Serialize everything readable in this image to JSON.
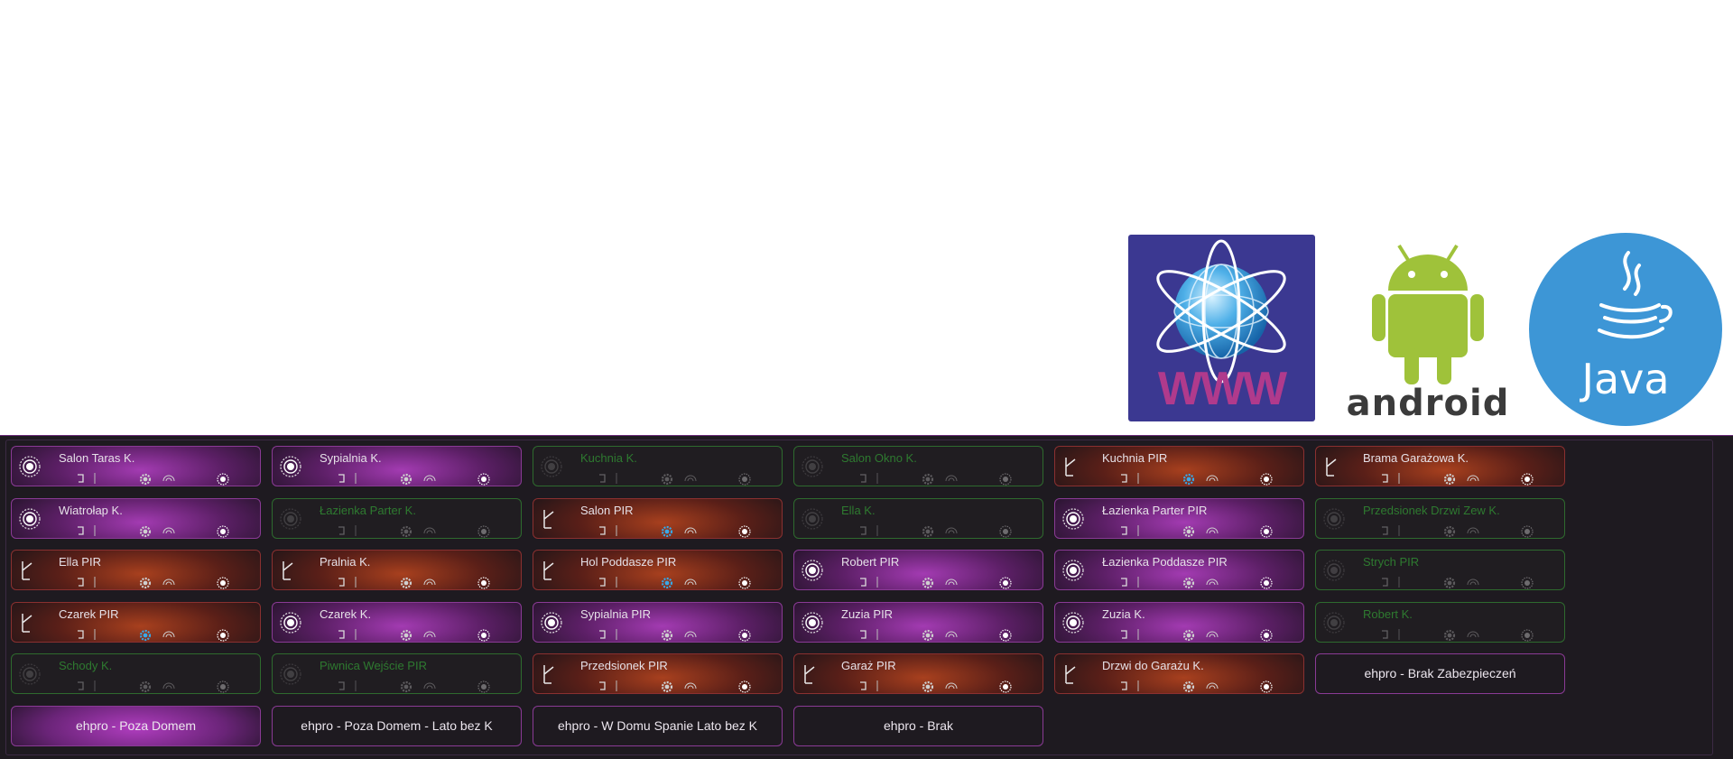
{
  "logos": {
    "www": "WWW",
    "android": "android",
    "java": "Java"
  },
  "colors": {
    "panel_bg": "#1e1a20",
    "armed_purple": "#a33bb2",
    "alarm_red": "#a8401e",
    "disabled_green": "#2e7a30"
  },
  "sensors": [
    {
      "label": "Salon Taras K.",
      "style": "purple",
      "icon": "sensor-round-icon"
    },
    {
      "label": "Sypialnia K.",
      "style": "purple",
      "icon": "sensor-round-icon"
    },
    {
      "label": "Kuchnia K.",
      "style": "green",
      "icon": "sensor-round-icon"
    },
    {
      "label": "Salon Okno K.",
      "style": "green",
      "icon": "sensor-round-icon"
    },
    {
      "label": "Kuchnia PIR",
      "style": "red",
      "icon": "pir-icon"
    },
    {
      "label": "Brama Garażowa K.",
      "style": "red",
      "icon": "pir-icon"
    },
    {
      "label": "Wiatrołap K.",
      "style": "purple",
      "icon": "sensor-round-icon"
    },
    {
      "label": "Łazienka Parter K.",
      "style": "green",
      "icon": "sensor-round-icon"
    },
    {
      "label": "Salon PIR",
      "style": "red",
      "icon": "pir-icon"
    },
    {
      "label": "Ella K.",
      "style": "green",
      "icon": "sensor-round-icon"
    },
    {
      "label": "Łazienka Parter PIR",
      "style": "purple",
      "icon": "sensor-round-icon"
    },
    {
      "label": "Przedsionek Drzwi Zew K.",
      "style": "green",
      "icon": "sensor-round-icon"
    },
    {
      "label": "Ella PIR",
      "style": "red",
      "icon": "pir-icon"
    },
    {
      "label": "Pralnia K.",
      "style": "red",
      "icon": "pir-icon"
    },
    {
      "label": "Hol Poddasze PIR",
      "style": "red",
      "icon": "pir-icon"
    },
    {
      "label": "Robert PIR",
      "style": "purple",
      "icon": "sensor-round-icon"
    },
    {
      "label": "Łazienka Poddasze PIR",
      "style": "purple",
      "icon": "sensor-round-icon"
    },
    {
      "label": "Strych PIR",
      "style": "green",
      "icon": "sensor-round-icon"
    },
    {
      "label": "Czarek PIR",
      "style": "red",
      "icon": "pir-icon"
    },
    {
      "label": "Czarek K.",
      "style": "purple",
      "icon": "sensor-round-icon"
    },
    {
      "label": "Sypialnia PIR",
      "style": "purple",
      "icon": "sensor-round-icon"
    },
    {
      "label": "Zuzia PIR",
      "style": "purple",
      "icon": "sensor-round-icon"
    },
    {
      "label": "Zuzia K.",
      "style": "purple",
      "icon": "sensor-round-icon"
    },
    {
      "label": "Robert K.",
      "style": "green",
      "icon": "sensor-round-icon"
    },
    {
      "label": "Schody K.",
      "style": "green",
      "icon": "sensor-round-icon"
    },
    {
      "label": "Piwnica Wejście PIR",
      "style": "green",
      "icon": "sensor-round-icon"
    },
    {
      "label": "Przedsionek PIR",
      "style": "red",
      "icon": "pir-icon"
    },
    {
      "label": "Garaż PIR",
      "style": "red",
      "icon": "pir-icon"
    },
    {
      "label": "Drzwi do Garażu K.",
      "style": "red",
      "icon": "pir-icon"
    }
  ],
  "modes": [
    {
      "label": "ehpro - Brak Zabezpieczeń",
      "active": false
    },
    {
      "label": "ehpro - Poza Domem",
      "active": true
    },
    {
      "label": "ehpro - Poza Domem - Lato bez K",
      "active": false
    },
    {
      "label": "ehpro - W Domu Spanie Lato bez K",
      "active": false
    },
    {
      "label": "ehpro - Brak",
      "active": false
    }
  ]
}
